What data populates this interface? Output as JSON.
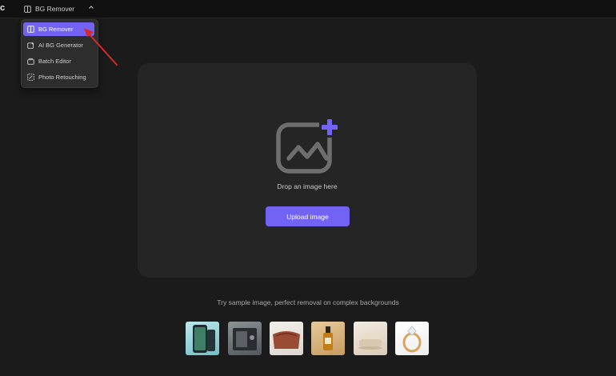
{
  "app": {
    "logo_fragment": "c",
    "tool_selector_label": "BG Remover"
  },
  "menu": {
    "items": [
      {
        "label": "BG Remover",
        "icon": "bg-remover-icon",
        "active": true
      },
      {
        "label": "AI BG Generator",
        "icon": "ai-generator-icon",
        "active": false
      },
      {
        "label": "Batch Editor",
        "icon": "batch-icon",
        "active": false
      },
      {
        "label": "Photo Retouching",
        "icon": "retouch-icon",
        "active": false
      }
    ]
  },
  "upload": {
    "drop_text": "Drop an image here",
    "button_label": "Upload image"
  },
  "samples": {
    "caption": "Try sample image, perfect removal on complex backgrounds",
    "items": [
      "phone",
      "machine",
      "bag",
      "serum-bottle",
      "armchair",
      "ring"
    ]
  },
  "colors": {
    "accent": "#7263f5",
    "background": "#1b1b1b",
    "panel": "#252525",
    "annotation_arrow": "#d62a2a"
  }
}
